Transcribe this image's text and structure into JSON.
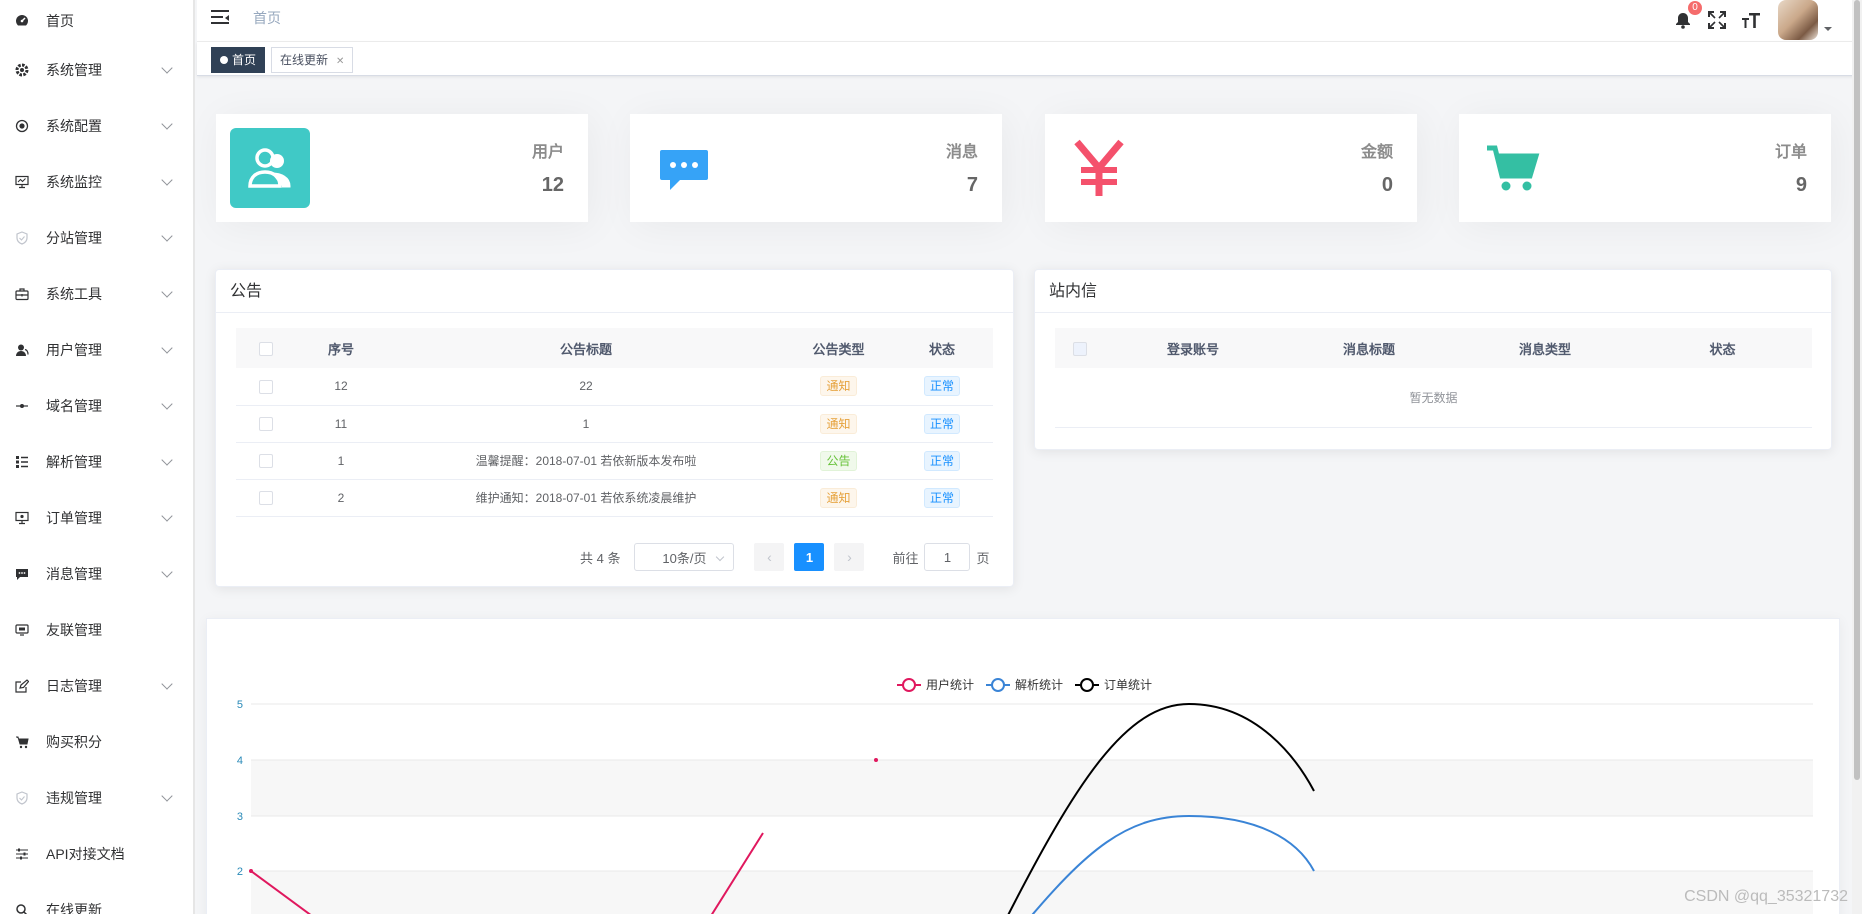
{
  "sidebar": {
    "items": [
      {
        "label": "首页",
        "icon": "dashboard-icon",
        "expandable": false
      },
      {
        "label": "系统管理",
        "icon": "gear-icon",
        "expandable": true
      },
      {
        "label": "系统配置",
        "icon": "radio-icon",
        "expandable": true
      },
      {
        "label": "系统监控",
        "icon": "monitor-icon",
        "expandable": true
      },
      {
        "label": "分站管理",
        "icon": "shield-icon",
        "expandable": true
      },
      {
        "label": "系统工具",
        "icon": "toolbox-icon",
        "expandable": true
      },
      {
        "label": "用户管理",
        "icon": "user-icon",
        "expandable": true
      },
      {
        "label": "域名管理",
        "icon": "link-icon",
        "expandable": true
      },
      {
        "label": "解析管理",
        "icon": "tree-list-icon",
        "expandable": true
      },
      {
        "label": "订单管理",
        "icon": "order-monitor-icon",
        "expandable": true
      },
      {
        "label": "消息管理",
        "icon": "message-icon",
        "expandable": true
      },
      {
        "label": "友联管理",
        "icon": "screen-icon",
        "expandable": false
      },
      {
        "label": "日志管理",
        "icon": "edit-log-icon",
        "expandable": true
      },
      {
        "label": "购买积分",
        "icon": "cart-icon",
        "expandable": false
      },
      {
        "label": "违规管理",
        "icon": "shield-check-icon",
        "expandable": true
      },
      {
        "label": "API对接文档",
        "icon": "sliders-icon",
        "expandable": false
      },
      {
        "label": "在线更新",
        "icon": "search-icon",
        "expandable": false
      }
    ]
  },
  "header": {
    "breadcrumb": "首页",
    "notification_count": "0"
  },
  "tags": [
    {
      "label": "首页",
      "active": true
    },
    {
      "label": "在线更新",
      "active": false
    }
  ],
  "stats": [
    {
      "title": "用户",
      "value": "12",
      "icon": "users-icon",
      "color": "#40c9c6"
    },
    {
      "title": "消息",
      "value": "7",
      "icon": "chat-icon",
      "color": "#36a3f7"
    },
    {
      "title": "金额",
      "value": "0",
      "icon": "yen-icon",
      "color": "#f4516c"
    },
    {
      "title": "订单",
      "value": "9",
      "icon": "shopping-cart-icon",
      "color": "#34bfa3"
    }
  ],
  "notice": {
    "title": "公告",
    "columns": [
      "序号",
      "公告标题",
      "公告类型",
      "状态"
    ],
    "rows": [
      {
        "id": "12",
        "title": "22",
        "type": "通知",
        "type_style": "warn",
        "status": "正常"
      },
      {
        "id": "11",
        "title": "1",
        "type": "通知",
        "type_style": "warn",
        "status": "正常"
      },
      {
        "id": "1",
        "title": "温馨提醒：2018-07-01 若依新版本发布啦",
        "type": "公告",
        "type_style": "succ",
        "status": "正常"
      },
      {
        "id": "2",
        "title": "维护通知：2018-07-01 若依系统凌晨维护",
        "type": "通知",
        "type_style": "warn",
        "status": "正常"
      }
    ],
    "pagination": {
      "total": "共 4 条",
      "page_size": "10条/页",
      "current_page": "1",
      "goto_label": "前往",
      "goto_value": "1",
      "page_suffix": "页"
    }
  },
  "inbox": {
    "title": "站内信",
    "columns": [
      "登录账号",
      "消息标题",
      "消息类型",
      "状态"
    ],
    "empty_text": "暂无数据"
  },
  "chart_data": {
    "type": "line",
    "series": [
      {
        "name": "用户统计",
        "color": "#e0185e"
      },
      {
        "name": "解析统计",
        "color": "#3a84d6"
      },
      {
        "name": "订单统计",
        "color": "#000000"
      }
    ],
    "y_tick_labels": [
      "5",
      "4",
      "3",
      "2"
    ],
    "grid": true,
    "legend_position": "top-center"
  },
  "watermark": "CSDN @qq_35321732"
}
